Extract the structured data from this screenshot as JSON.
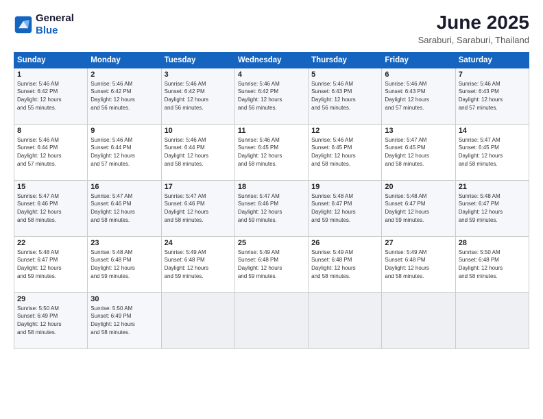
{
  "logo": {
    "line1": "General",
    "line2": "Blue"
  },
  "title": "June 2025",
  "location": "Saraburi, Saraburi, Thailand",
  "weekdays": [
    "Sunday",
    "Monday",
    "Tuesday",
    "Wednesday",
    "Thursday",
    "Friday",
    "Saturday"
  ],
  "weeks": [
    [
      {
        "day": 1,
        "info": "Sunrise: 5:46 AM\nSunset: 6:42 PM\nDaylight: 12 hours\nand 55 minutes."
      },
      {
        "day": 2,
        "info": "Sunrise: 5:46 AM\nSunset: 6:42 PM\nDaylight: 12 hours\nand 56 minutes."
      },
      {
        "day": 3,
        "info": "Sunrise: 5:46 AM\nSunset: 6:42 PM\nDaylight: 12 hours\nand 56 minutes."
      },
      {
        "day": 4,
        "info": "Sunrise: 5:46 AM\nSunset: 6:42 PM\nDaylight: 12 hours\nand 56 minutes."
      },
      {
        "day": 5,
        "info": "Sunrise: 5:46 AM\nSunset: 6:43 PM\nDaylight: 12 hours\nand 56 minutes."
      },
      {
        "day": 6,
        "info": "Sunrise: 5:46 AM\nSunset: 6:43 PM\nDaylight: 12 hours\nand 57 minutes."
      },
      {
        "day": 7,
        "info": "Sunrise: 5:46 AM\nSunset: 6:43 PM\nDaylight: 12 hours\nand 57 minutes."
      }
    ],
    [
      {
        "day": 8,
        "info": "Sunrise: 5:46 AM\nSunset: 6:44 PM\nDaylight: 12 hours\nand 57 minutes."
      },
      {
        "day": 9,
        "info": "Sunrise: 5:46 AM\nSunset: 6:44 PM\nDaylight: 12 hours\nand 57 minutes."
      },
      {
        "day": 10,
        "info": "Sunrise: 5:46 AM\nSunset: 6:44 PM\nDaylight: 12 hours\nand 58 minutes."
      },
      {
        "day": 11,
        "info": "Sunrise: 5:46 AM\nSunset: 6:45 PM\nDaylight: 12 hours\nand 58 minutes."
      },
      {
        "day": 12,
        "info": "Sunrise: 5:46 AM\nSunset: 6:45 PM\nDaylight: 12 hours\nand 58 minutes."
      },
      {
        "day": 13,
        "info": "Sunrise: 5:47 AM\nSunset: 6:45 PM\nDaylight: 12 hours\nand 58 minutes."
      },
      {
        "day": 14,
        "info": "Sunrise: 5:47 AM\nSunset: 6:45 PM\nDaylight: 12 hours\nand 58 minutes."
      }
    ],
    [
      {
        "day": 15,
        "info": "Sunrise: 5:47 AM\nSunset: 6:46 PM\nDaylight: 12 hours\nand 58 minutes."
      },
      {
        "day": 16,
        "info": "Sunrise: 5:47 AM\nSunset: 6:46 PM\nDaylight: 12 hours\nand 58 minutes."
      },
      {
        "day": 17,
        "info": "Sunrise: 5:47 AM\nSunset: 6:46 PM\nDaylight: 12 hours\nand 58 minutes."
      },
      {
        "day": 18,
        "info": "Sunrise: 5:47 AM\nSunset: 6:46 PM\nDaylight: 12 hours\nand 59 minutes."
      },
      {
        "day": 19,
        "info": "Sunrise: 5:48 AM\nSunset: 6:47 PM\nDaylight: 12 hours\nand 59 minutes."
      },
      {
        "day": 20,
        "info": "Sunrise: 5:48 AM\nSunset: 6:47 PM\nDaylight: 12 hours\nand 59 minutes."
      },
      {
        "day": 21,
        "info": "Sunrise: 5:48 AM\nSunset: 6:47 PM\nDaylight: 12 hours\nand 59 minutes."
      }
    ],
    [
      {
        "day": 22,
        "info": "Sunrise: 5:48 AM\nSunset: 6:47 PM\nDaylight: 12 hours\nand 59 minutes."
      },
      {
        "day": 23,
        "info": "Sunrise: 5:48 AM\nSunset: 6:48 PM\nDaylight: 12 hours\nand 59 minutes."
      },
      {
        "day": 24,
        "info": "Sunrise: 5:49 AM\nSunset: 6:48 PM\nDaylight: 12 hours\nand 59 minutes."
      },
      {
        "day": 25,
        "info": "Sunrise: 5:49 AM\nSunset: 6:48 PM\nDaylight: 12 hours\nand 59 minutes."
      },
      {
        "day": 26,
        "info": "Sunrise: 5:49 AM\nSunset: 6:48 PM\nDaylight: 12 hours\nand 58 minutes."
      },
      {
        "day": 27,
        "info": "Sunrise: 5:49 AM\nSunset: 6:48 PM\nDaylight: 12 hours\nand 58 minutes."
      },
      {
        "day": 28,
        "info": "Sunrise: 5:50 AM\nSunset: 6:48 PM\nDaylight: 12 hours\nand 58 minutes."
      }
    ],
    [
      {
        "day": 29,
        "info": "Sunrise: 5:50 AM\nSunset: 6:49 PM\nDaylight: 12 hours\nand 58 minutes."
      },
      {
        "day": 30,
        "info": "Sunrise: 5:50 AM\nSunset: 6:49 PM\nDaylight: 12 hours\nand 58 minutes."
      },
      null,
      null,
      null,
      null,
      null
    ]
  ]
}
